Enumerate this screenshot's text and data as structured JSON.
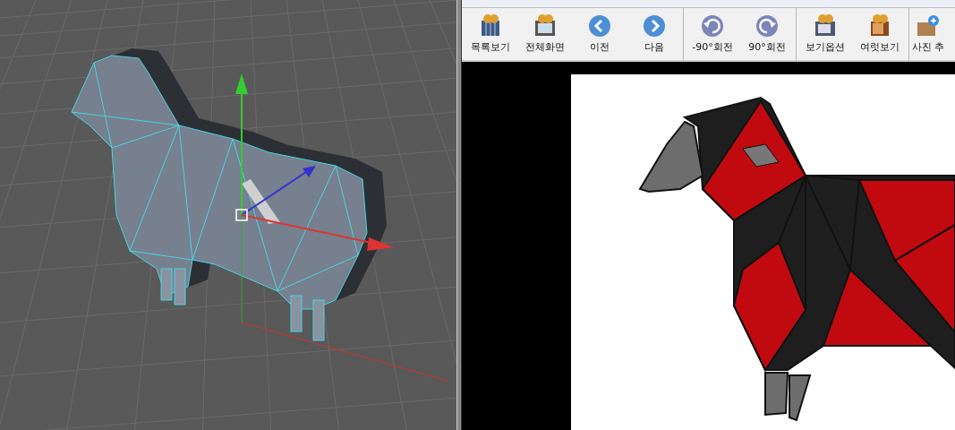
{
  "viewer": {
    "toolbar_groups": [
      [
        {
          "kind": "list",
          "label": "목록보기"
        },
        {
          "kind": "fullscreen",
          "label": "전체화면"
        },
        {
          "kind": "prev",
          "label": "이전"
        },
        {
          "kind": "next",
          "label": "다음"
        }
      ],
      [
        {
          "kind": "rotate-left",
          "label": "-90°회전"
        },
        {
          "kind": "rotate-right",
          "label": "90°회전"
        }
      ],
      [
        {
          "kind": "options",
          "label": "보기옵션"
        },
        {
          "kind": "multi",
          "label": "여럿보기"
        }
      ],
      [
        {
          "kind": "add",
          "label": "사진 추"
        }
      ]
    ]
  }
}
